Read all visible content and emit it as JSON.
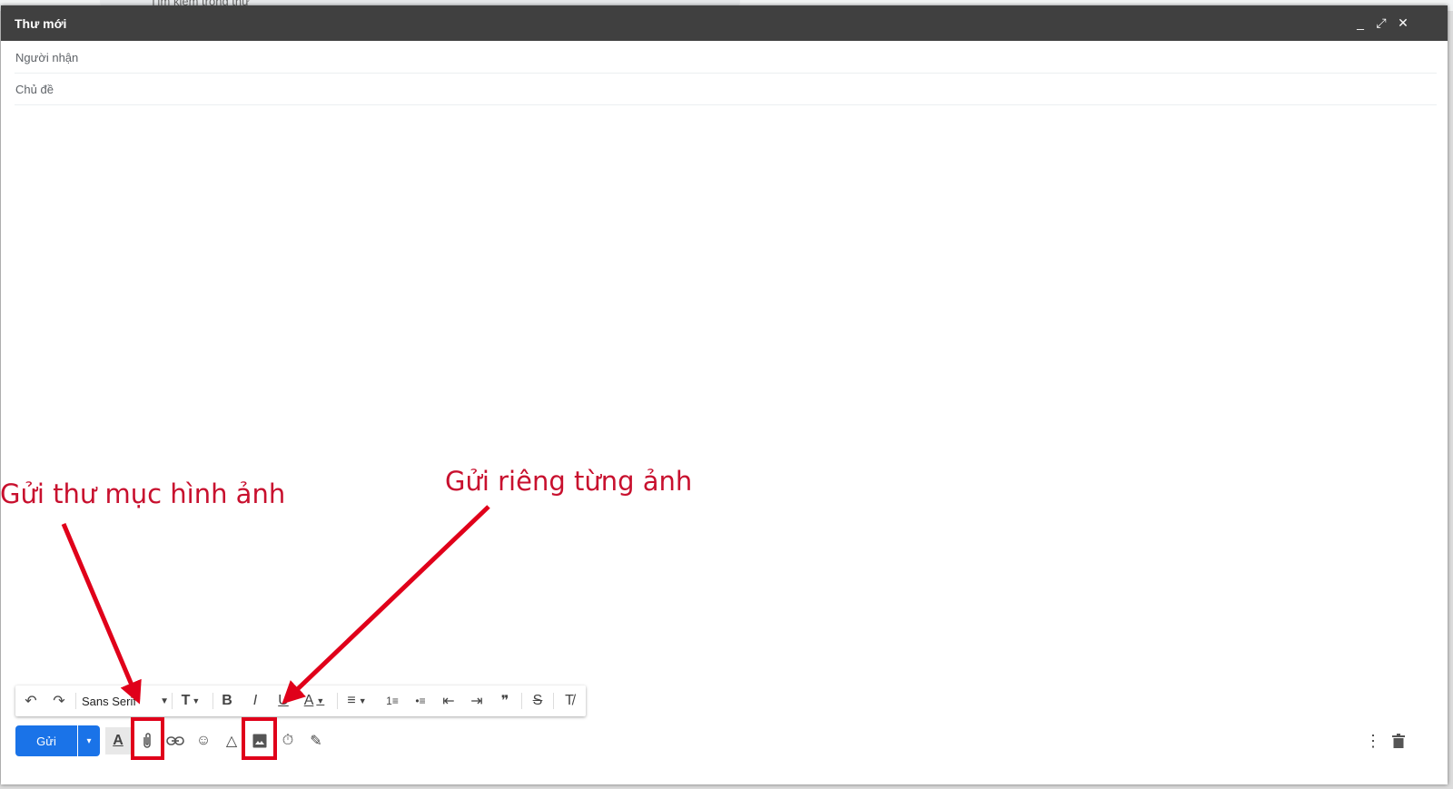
{
  "background": {
    "search_placeholder": "Tìm kiếm trong thư"
  },
  "compose": {
    "title": "Thư mới",
    "controls": {
      "minimize": "_",
      "fullscreen": "⤢",
      "close": "✕"
    },
    "recipients_placeholder": "Người nhận",
    "subject_placeholder": "Chủ đề",
    "body_text": ""
  },
  "formatting": {
    "undo": "↶",
    "redo": "↷",
    "font_family": "Sans Serif",
    "size": "T",
    "bold": "B",
    "italic": "I",
    "underline": "U",
    "text_color": "A",
    "align": "≡",
    "numbered_list": "1≡",
    "bulleted_list": "•≡",
    "indent_less": "⇤",
    "indent_more": "⇥",
    "quote": "❞",
    "strikethrough": "S",
    "remove_formatting": "T̸"
  },
  "bottom_toolbar": {
    "send_label": "Gửi",
    "send_more": "▾",
    "formatting_options": "A",
    "attach_files": "📎",
    "insert_link": "🔗",
    "insert_emoji": "☺",
    "insert_drive": "△",
    "insert_photo": "▣",
    "confidential_mode": "⏱",
    "insert_signature": "✎",
    "more_options": "⋮",
    "discard": "🗑"
  },
  "annotations": {
    "left_label": "Gửi thư mục hình ảnh",
    "right_label": "Gửi riêng từng ảnh"
  },
  "colors": {
    "titlebar": "#404040",
    "send_button": "#1a73e8",
    "annotation": "#c8102e",
    "highlight": "#e0001a"
  }
}
